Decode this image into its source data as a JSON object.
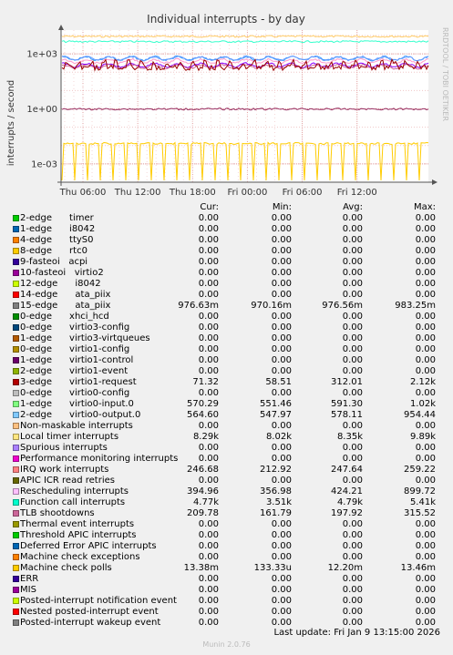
{
  "chart_data": {
    "type": "line",
    "title": "Individual interrupts - by day",
    "ylabel": "interrupts / second",
    "yscale": "log",
    "ylim": [
      0.0001,
      20000
    ],
    "yticks": [
      "1e+03",
      "1e+00",
      "1e-03"
    ],
    "xticks": [
      "Thu 06:00",
      "Thu 12:00",
      "Thu 18:00",
      "Fri 00:00",
      "Fri 06:00",
      "Fri 12:00"
    ],
    "grid": true,
    "series_shapes": [
      {
        "name": "Local timer interrupts",
        "level": 9000,
        "color": "#FFCC66"
      },
      {
        "name": "Function call interrupts",
        "level": 4700,
        "color": "#33FFCC"
      },
      {
        "name": "2-edge virtio0-output.0",
        "level": 564,
        "color": "#3399FF"
      },
      {
        "name": "1-edge virtio0-input.0",
        "level": 570,
        "color": "#6699FF"
      },
      {
        "name": "Rescheduling interrupts",
        "level": 400,
        "color": "#FF99CC"
      },
      {
        "name": "IRQ work interrupts",
        "level": 240,
        "color": "#8A00FF"
      },
      {
        "name": "TLB shootdowns",
        "level": 200,
        "color": "#CC6699"
      },
      {
        "name": "3-edge virtio1-request",
        "level": 100,
        "color": "#990000"
      },
      {
        "name": "15-edge ata_piix",
        "level": 0.977,
        "color": "#993366"
      },
      {
        "name": "Machine check polls",
        "level": 0.013,
        "color": "#FFCC00"
      }
    ]
  },
  "legend": {
    "headers": {
      "cur": "Cur:",
      "min": "Min:",
      "avg": "Avg:",
      "max": "Max:"
    },
    "rows": [
      {
        "name": "2-edge      timer",
        "cur": "0.00",
        "min": "0.00",
        "avg": "0.00",
        "max": "0.00",
        "color": "#00CC00"
      },
      {
        "name": "1-edge      i8042",
        "cur": "0.00",
        "min": "0.00",
        "avg": "0.00",
        "max": "0.00",
        "color": "#0066B3"
      },
      {
        "name": "4-edge      ttyS0",
        "cur": "0.00",
        "min": "0.00",
        "avg": "0.00",
        "max": "0.00",
        "color": "#FF8000"
      },
      {
        "name": "8-edge      rtc0",
        "cur": "0.00",
        "min": "0.00",
        "avg": "0.00",
        "max": "0.00",
        "color": "#FFCC00"
      },
      {
        "name": "9-fasteoi   acpi",
        "cur": "0.00",
        "min": "0.00",
        "avg": "0.00",
        "max": "0.00",
        "color": "#330099"
      },
      {
        "name": "10-fasteoi   virtio2",
        "cur": "0.00",
        "min": "0.00",
        "avg": "0.00",
        "max": "0.00",
        "color": "#990099"
      },
      {
        "name": "12-edge      i8042",
        "cur": "0.00",
        "min": "0.00",
        "avg": "0.00",
        "max": "0.00",
        "color": "#CCFF00"
      },
      {
        "name": "14-edge      ata_piix",
        "cur": "0.00",
        "min": "0.00",
        "avg": "0.00",
        "max": "0.00",
        "color": "#FF0000"
      },
      {
        "name": "15-edge      ata_piix",
        "cur": "976.63m",
        "min": "970.16m",
        "avg": "976.56m",
        "max": "983.25m",
        "color": "#808080"
      },
      {
        "name": "0-edge      xhci_hcd",
        "cur": "0.00",
        "min": "0.00",
        "avg": "0.00",
        "max": "0.00",
        "color": "#008F00"
      },
      {
        "name": "0-edge      virtio3-config",
        "cur": "0.00",
        "min": "0.00",
        "avg": "0.00",
        "max": "0.00",
        "color": "#00487D"
      },
      {
        "name": "1-edge      virtio3-virtqueues",
        "cur": "0.00",
        "min": "0.00",
        "avg": "0.00",
        "max": "0.00",
        "color": "#B35A00"
      },
      {
        "name": "0-edge      virtio1-config",
        "cur": "0.00",
        "min": "0.00",
        "avg": "0.00",
        "max": "0.00",
        "color": "#B38F00"
      },
      {
        "name": "1-edge      virtio1-control",
        "cur": "0.00",
        "min": "0.00",
        "avg": "0.00",
        "max": "0.00",
        "color": "#6B006B"
      },
      {
        "name": "2-edge      virtio1-event",
        "cur": "0.00",
        "min": "0.00",
        "avg": "0.00",
        "max": "0.00",
        "color": "#8FB300"
      },
      {
        "name": "3-edge      virtio1-request",
        "cur": "71.32",
        "min": "58.51",
        "avg": "312.01",
        "max": "2.12k",
        "color": "#B30000"
      },
      {
        "name": "0-edge      virtio0-config",
        "cur": "0.00",
        "min": "0.00",
        "avg": "0.00",
        "max": "0.00",
        "color": "#BEBEBE"
      },
      {
        "name": "1-edge      virtio0-input.0",
        "cur": "570.29",
        "min": "551.46",
        "avg": "591.30",
        "max": "1.02k",
        "color": "#80FF80"
      },
      {
        "name": "2-edge      virtio0-output.0",
        "cur": "564.60",
        "min": "547.97",
        "avg": "578.11",
        "max": "954.44",
        "color": "#80C9FF"
      },
      {
        "name": "Non-maskable interrupts",
        "cur": "0.00",
        "min": "0.00",
        "avg": "0.00",
        "max": "0.00",
        "color": "#FFC080"
      },
      {
        "name": "Local timer interrupts",
        "cur": "8.29k",
        "min": "8.02k",
        "avg": "8.35k",
        "max": "9.89k",
        "color": "#FFE680"
      },
      {
        "name": "Spurious interrupts",
        "cur": "0.00",
        "min": "0.00",
        "avg": "0.00",
        "max": "0.00",
        "color": "#AA80FF"
      },
      {
        "name": "Performance monitoring interrupts",
        "cur": "0.00",
        "min": "0.00",
        "avg": "0.00",
        "max": "0.00",
        "color": "#EE00CC"
      },
      {
        "name": "IRQ work interrupts",
        "cur": "246.68",
        "min": "212.92",
        "avg": "247.64",
        "max": "259.22",
        "color": "#FF8080"
      },
      {
        "name": "APIC ICR read retries",
        "cur": "0.00",
        "min": "0.00",
        "avg": "0.00",
        "max": "0.00",
        "color": "#666600"
      },
      {
        "name": "Rescheduling interrupts",
        "cur": "394.96",
        "min": "356.98",
        "avg": "424.21",
        "max": "899.72",
        "color": "#FFBFFF"
      },
      {
        "name": "Function call interrupts",
        "cur": "4.77k",
        "min": "3.51k",
        "avg": "4.79k",
        "max": "5.41k",
        "color": "#00FFCC"
      },
      {
        "name": "TLB shootdowns",
        "cur": "209.78",
        "min": "161.79",
        "avg": "197.92",
        "max": "315.52",
        "color": "#CC6699"
      },
      {
        "name": "Thermal event interrupts",
        "cur": "0.00",
        "min": "0.00",
        "avg": "0.00",
        "max": "0.00",
        "color": "#999900"
      },
      {
        "name": "Threshold APIC interrupts",
        "cur": "0.00",
        "min": "0.00",
        "avg": "0.00",
        "max": "0.00",
        "color": "#00CC00"
      },
      {
        "name": "Deferred Error APIC interrupts",
        "cur": "0.00",
        "min": "0.00",
        "avg": "0.00",
        "max": "0.00",
        "color": "#0066B3"
      },
      {
        "name": "Machine check exceptions",
        "cur": "0.00",
        "min": "0.00",
        "avg": "0.00",
        "max": "0.00",
        "color": "#FF8000"
      },
      {
        "name": "Machine check polls",
        "cur": "13.38m",
        "min": "133.33u",
        "avg": "12.20m",
        "max": "13.46m",
        "color": "#FFCC00"
      },
      {
        "name": "ERR",
        "cur": "0.00",
        "min": "0.00",
        "avg": "0.00",
        "max": "0.00",
        "color": "#330099"
      },
      {
        "name": "MIS",
        "cur": "0.00",
        "min": "0.00",
        "avg": "0.00",
        "max": "0.00",
        "color": "#990099"
      },
      {
        "name": "Posted-interrupt notification event",
        "cur": "0.00",
        "min": "0.00",
        "avg": "0.00",
        "max": "0.00",
        "color": "#CCFF00"
      },
      {
        "name": "Nested posted-interrupt event",
        "cur": "0.00",
        "min": "0.00",
        "avg": "0.00",
        "max": "0.00",
        "color": "#FF0000"
      },
      {
        "name": "Posted-interrupt wakeup event",
        "cur": "0.00",
        "min": "0.00",
        "avg": "0.00",
        "max": "0.00",
        "color": "#808080"
      }
    ]
  },
  "last_update": "Last update: Fri Jan  9 13:15:00 2026",
  "footer": "Munin 2.0.76",
  "watermark": "RRDTOOL / TOBI OETIKER"
}
